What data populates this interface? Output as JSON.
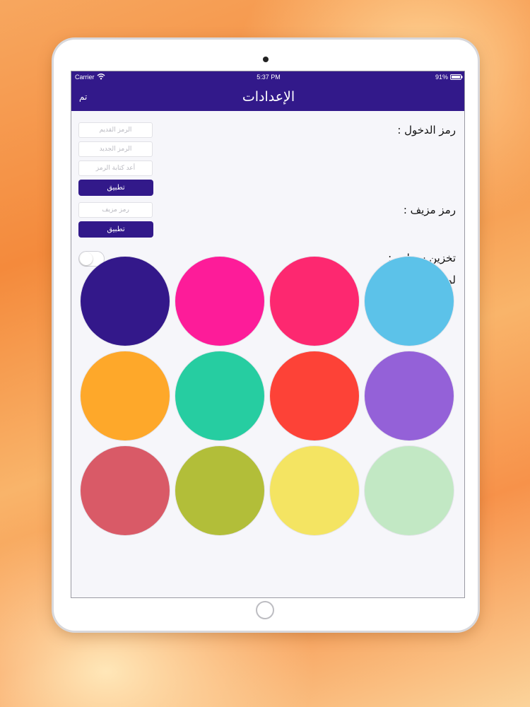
{
  "status_bar": {
    "carrier": "Carrier",
    "time": "5:37 PM",
    "battery": "91%"
  },
  "nav": {
    "title": "الإعدادات",
    "done": "تم"
  },
  "passcode": {
    "label": "رمز الدخول :",
    "old_placeholder": "الرمز القديم",
    "new_placeholder": "الرمز الجديد",
    "confirm_placeholder": "أعد كتابة الرمز",
    "apply": "تطبيق"
  },
  "fake_passcode": {
    "label": "رمز مزيف :",
    "placeholder": "رمز مزيف",
    "apply": "تطبيق"
  },
  "cloud_storage": {
    "label": "تخزين سحابي :",
    "enabled": false
  },
  "color": {
    "label": "لون :",
    "swatches": [
      "#33188a",
      "#fd1c99",
      "#fd2870",
      "#5cc2e9",
      "#fea82a",
      "#26cda1",
      "#fd4237",
      "#9461d8",
      "#d95a67",
      "#b2be39",
      "#f4e462",
      "#c2e8c4"
    ]
  }
}
